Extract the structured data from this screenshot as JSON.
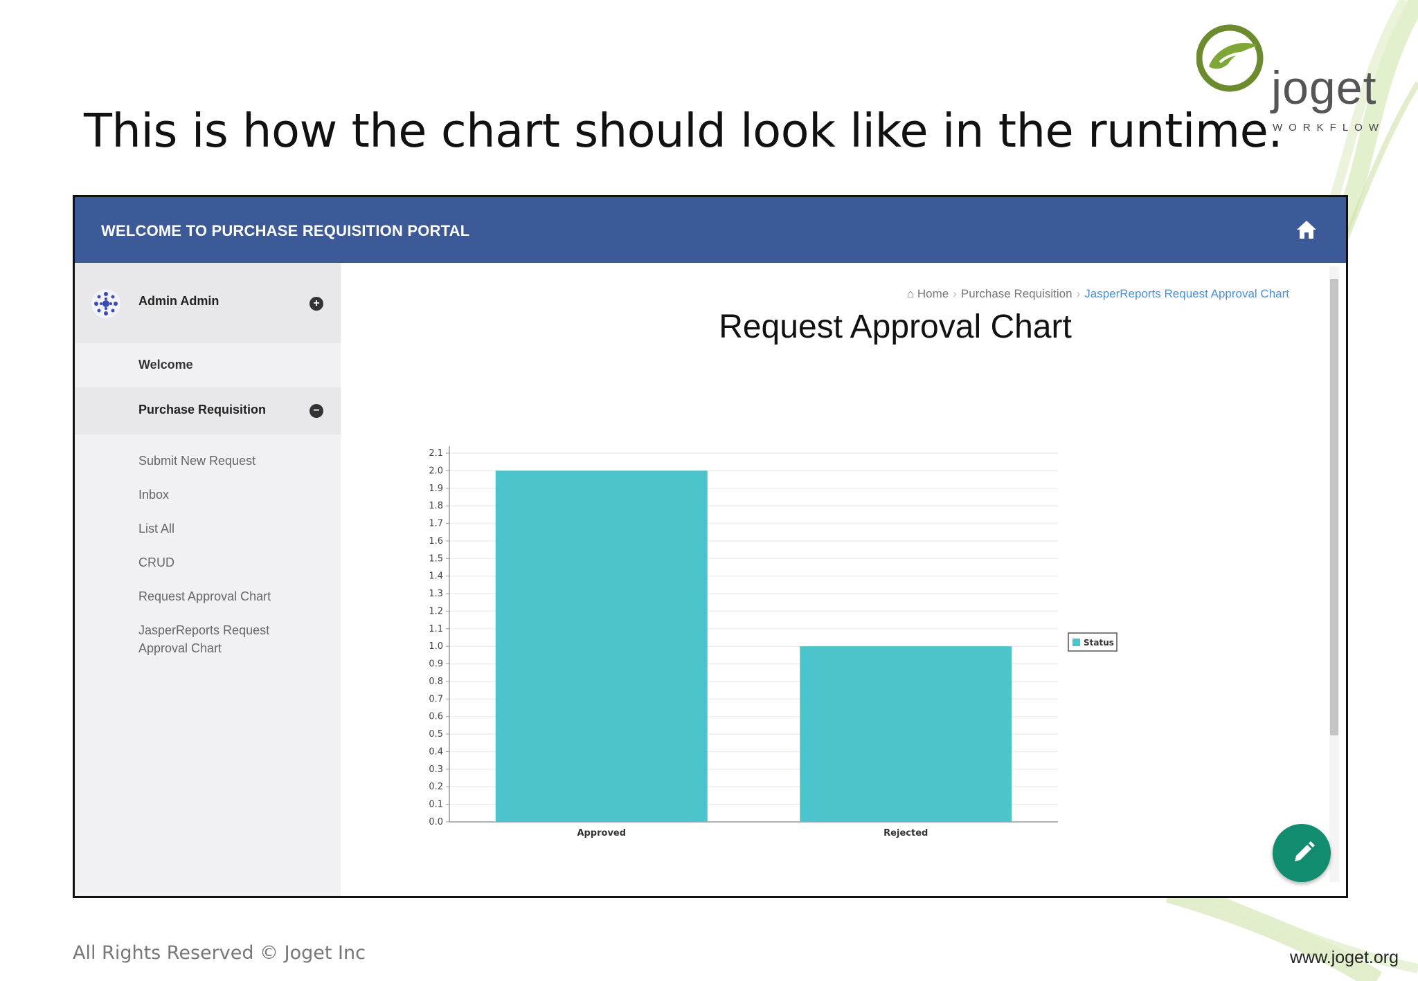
{
  "slide": {
    "title": "This is how the chart should look like in the runtime.",
    "footer_left": "All Rights Reserved © Joget Inc",
    "footer_right": "www.joget.org",
    "logo_word": "joget",
    "logo_sub": "WORKFLOW"
  },
  "app": {
    "header_title": "WELCOME TO PURCHASE REQUISITION PORTAL",
    "colors": {
      "header": "#3d5a98",
      "bar": "#4bc4cb",
      "fab": "#128c6f",
      "breadcrumb_active": "#4a90d9"
    },
    "user": {
      "name": "Admin Admin"
    },
    "nav": {
      "welcome": "Welcome",
      "purchase_requisition": "Purchase Requisition",
      "sub_items": [
        "Submit New Request",
        "Inbox",
        "List All",
        "CRUD",
        "Request Approval Chart",
        "JasperReports Request Approval Chart"
      ]
    },
    "breadcrumb": {
      "home": "Home",
      "section": "Purchase Requisition",
      "current": "JasperReports Request Approval Chart"
    },
    "icons": {
      "home": "home-icon",
      "edit": "pencil-icon",
      "expand": "plus-circle-icon",
      "collapse": "minus-circle-icon"
    }
  },
  "chart_data": {
    "type": "bar",
    "title": "Request Approval Chart",
    "categories": [
      "Approved",
      "Rejected"
    ],
    "series": [
      {
        "name": "Status",
        "values": [
          2.0,
          1.0
        ]
      }
    ],
    "ylim": [
      0,
      2.1
    ],
    "yticks": [
      "0.0",
      "0.1",
      "0.2",
      "0.3",
      "0.4",
      "0.5",
      "0.6",
      "0.7",
      "0.8",
      "0.9",
      "1.0",
      "1.1",
      "1.2",
      "1.3",
      "1.4",
      "1.5",
      "1.6",
      "1.7",
      "1.8",
      "1.9",
      "2.0",
      "2.1"
    ],
    "grid": true,
    "legend": "right"
  }
}
